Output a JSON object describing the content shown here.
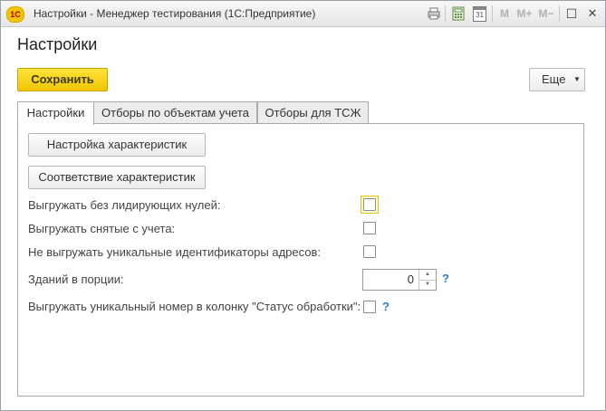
{
  "window": {
    "title": "Настройки  - Менеджер тестирования (1С:Предприятие)",
    "logo_text": "1С",
    "toolbar": {
      "print_icon": "printer-icon",
      "calculator_icon": "calculator-icon",
      "calendar_icon": "calendar-icon",
      "calendar_day": "31",
      "mem_m": "M",
      "mem_m_plus": "M+",
      "mem_m_minus": "M−",
      "restore_glyph": "☐",
      "close_glyph": "✕"
    }
  },
  "page": {
    "title": "Настройки"
  },
  "command_bar": {
    "save_label": "Сохранить",
    "more_label": "Еще",
    "more_arrow": "▼"
  },
  "tabs": [
    {
      "label": "Настройки",
      "active": true
    },
    {
      "label": "Отборы по объектам учета",
      "active": false
    },
    {
      "label": "Отборы для ТСЖ",
      "active": false
    }
  ],
  "settings": {
    "btn_char_setup": "Настройка характеристик",
    "btn_char_match": "Соответствие характеристик",
    "fields": [
      {
        "label": "Выгружать без лидирующих нулей:",
        "checked": false
      },
      {
        "label": "Выгружать снятые с учета:",
        "checked": false
      },
      {
        "label": "Не выгружать уникальные идентификаторы адресов:",
        "checked": false
      }
    ],
    "buildings": {
      "label": "Зданий в порции:",
      "value": "0",
      "spin_up": "▲",
      "spin_down": "▼",
      "help": "?"
    },
    "unique_number": {
      "label": "Выгружать уникальный номер в колонку \"Статус обработки\":",
      "checked": false,
      "help": "?"
    }
  }
}
